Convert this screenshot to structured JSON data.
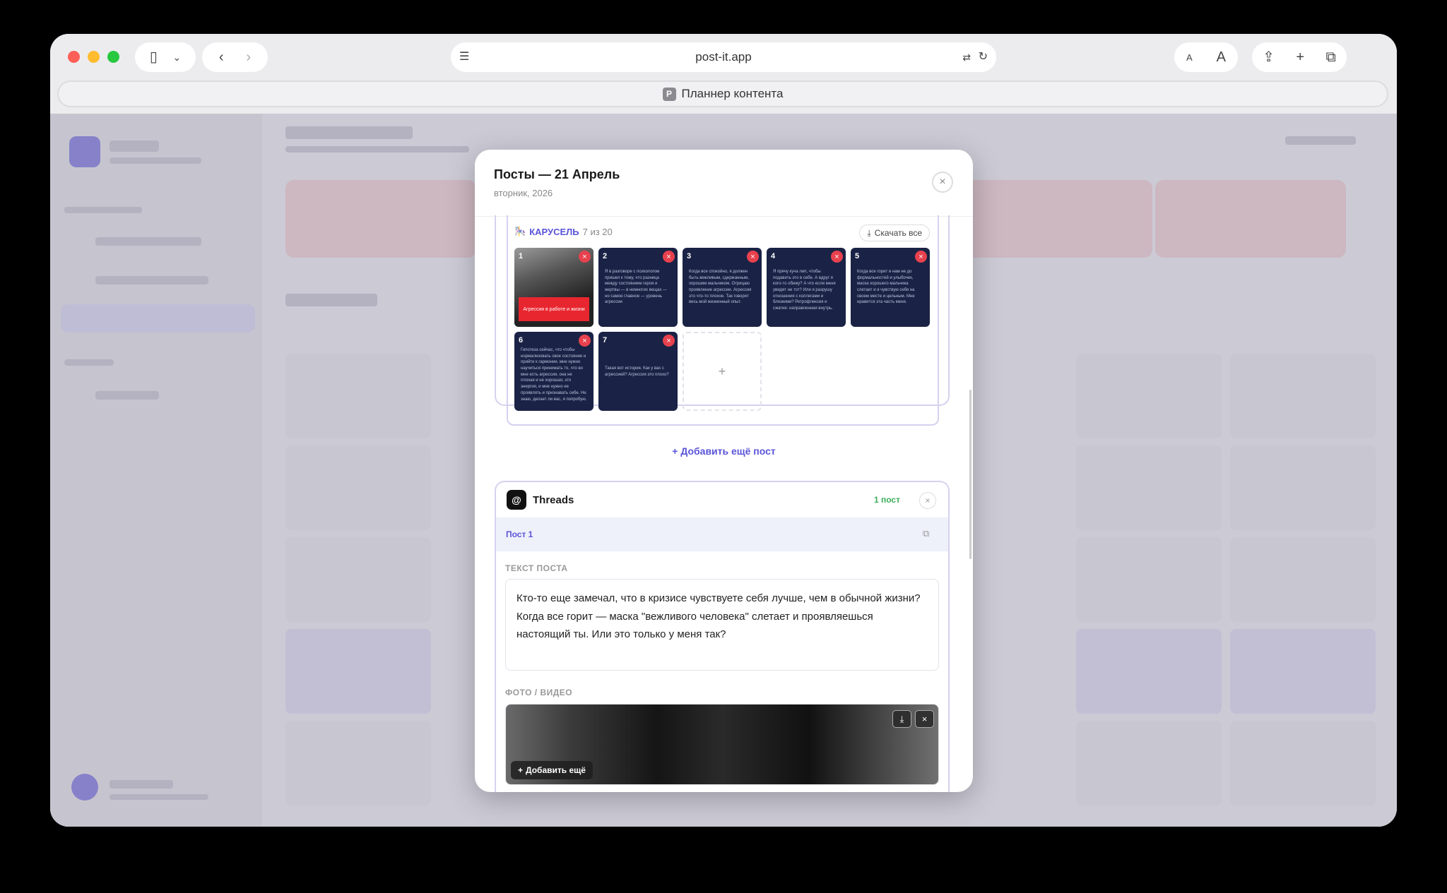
{
  "browser": {
    "url": "post-it.app",
    "tab_title": "Планнер контента",
    "favicon_letter": "P"
  },
  "modal": {
    "title": "Посты — 21 Апрель",
    "subtitle": "вторник, 2026",
    "close_icon": "×",
    "carousel": {
      "label": "КАРУСЕЛЬ",
      "count": "7 из 20",
      "download_label": "Скачать все",
      "slides": [
        {
          "num": "1",
          "banner": "Агрессия в работе и жизни"
        },
        {
          "num": "2",
          "text": "Я в разговоре с психологом пришел к тому, что разница между состоянием героя и жертвы — в немногих вещах — но самое главное — уровень агрессии"
        },
        {
          "num": "3",
          "text": "Когда все спокойно, я должен быть вежливым, сдержанным, хорошим мальчиком. Отрицаю проявление агрессии. Агрессия это что-то плохое. Так говорит весь мой жизненный опыт."
        },
        {
          "num": "4",
          "text": "Я прячу куча лип, чтобы подавить это в себе. А вдруг я кого-то обижу? А что если меня увидят не тот? Или я разрушу отношения с коллегами и близкими? Ретрофлексия и сжатие: направленная внутрь."
        },
        {
          "num": "5",
          "text": "Когда все горит и нам не до формальностей и улыбочек, маска хорошего мальчика слетает и я чувствую себя на своем месте и цельным. Мне нравится эта часть меня."
        },
        {
          "num": "6",
          "text": "Гипотеза сейчас, что чтобы нормализовать свое состояние и прийти к гармонии, мне нужно научиться принимать то, что во мне есть агрессия, она не плохая и не хорошая, это энергия, и мне нужно ее проявлять и признавать себе. Не знаю, делает ли вас, я попробую."
        },
        {
          "num": "7",
          "text": "Такая вот история. Как у вас с агрессией? Агрессия это плохо?"
        }
      ],
      "add_slide": "+"
    },
    "add_post_label": "Добавить ещё пост",
    "threads": {
      "name": "Threads",
      "badge": "1 пост",
      "post_label": "Пост 1",
      "text_label": "ТЕКСТ ПОСТА",
      "text": "Кто-то еще замечал, что в кризисе чувствуете себя лучше, чем в обычной жизни? Когда все горит — маска \"вежливого человека\" слетает и проявляешься настоящий ты. Или это только у меня так?",
      "media_label": "ФОТО / ВИДЕО",
      "media_add": "Добавить ещё"
    }
  },
  "colors": {
    "accent": "#5a54d8",
    "slide_bg": "#1a2345",
    "delete": "#e8414e",
    "success": "#3cae5a"
  }
}
